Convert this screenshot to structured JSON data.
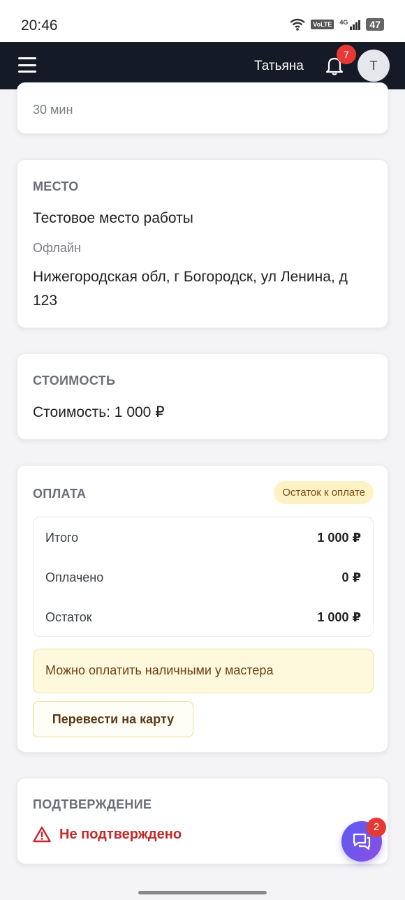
{
  "status_bar": {
    "time": "20:46",
    "volte": "VoLTE",
    "network": "4G",
    "battery": "47"
  },
  "header": {
    "user_name": "Татьяна",
    "notifications_count": "7",
    "avatar_initial": "Т"
  },
  "duration_card": {
    "value": "30 мин"
  },
  "place_card": {
    "title": "МЕСТО",
    "place_name": "Тестовое место работы",
    "mode": "Офлайн",
    "address": "Нижегородская обл, г Богородск, ул Ленина, д 123"
  },
  "price_card": {
    "title": "СТОИМОСТЬ",
    "price_text": "Стоимость: 1 000 ₽"
  },
  "payment_card": {
    "title": "ОПЛАТА",
    "status_badge": "Остаток к оплате",
    "rows": [
      {
        "label": "Итого",
        "value": "1 000 ₽"
      },
      {
        "label": "Оплачено",
        "value": "0 ₽"
      },
      {
        "label": "Остаток",
        "value": "1 000 ₽"
      }
    ],
    "notice": "Можно оплатить наличными у мастера",
    "transfer_button": "Перевести на карту"
  },
  "confirmation_card": {
    "title": "ПОДТВЕРЖДЕНИЕ",
    "status": "Не подтверждено"
  },
  "chat": {
    "unread_count": "2"
  },
  "colors": {
    "header_bg": "#151a27",
    "badge_red": "#e53935",
    "warning_red": "#c62828",
    "notice_bg": "#fef8dc",
    "pill_bg": "#fdf2c4"
  },
  "icons": [
    "menu-icon",
    "bell-icon",
    "warning-icon",
    "chat-icon",
    "wifi-icon",
    "signal-icon"
  ]
}
